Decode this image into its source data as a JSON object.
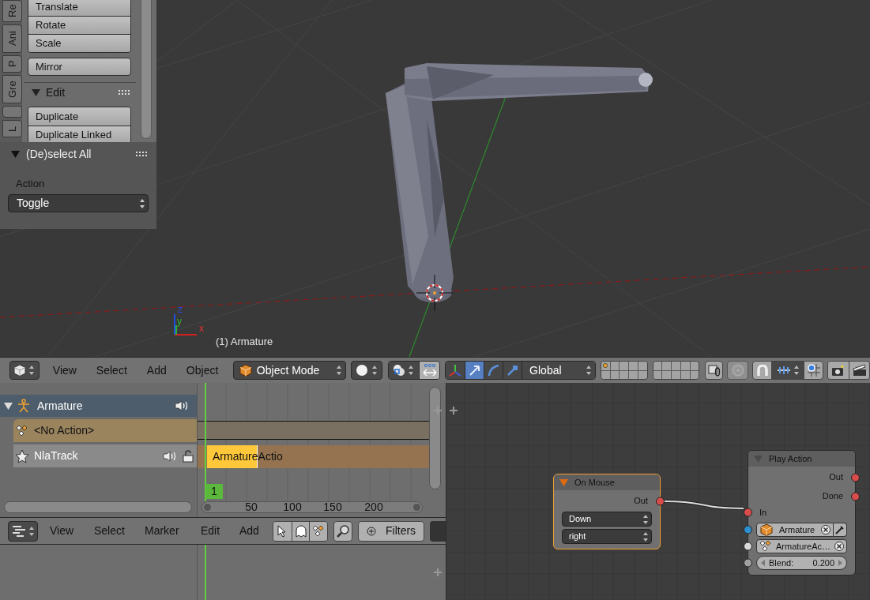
{
  "viewport": {
    "tool_tabs": [
      {
        "kind": "tab",
        "label": "Re"
      },
      {
        "kind": "tab",
        "label": "Ani"
      },
      {
        "kind": "tab",
        "label": "P"
      },
      {
        "kind": "tab",
        "label": "Gre"
      },
      {
        "kind": "blank"
      },
      {
        "kind": "tab",
        "label": "L"
      }
    ],
    "transform_buttons": [
      "Translate",
      "Rotate",
      "Scale"
    ],
    "mirror_button": "Mirror",
    "edit_panel": {
      "title": "Edit",
      "expanded": true,
      "buttons": [
        "Duplicate",
        "Duplicate Linked"
      ]
    },
    "operator_panel": {
      "title": "(De)select All",
      "expanded": true,
      "property": "Action",
      "value": "Toggle"
    },
    "axis_labels": [
      "z",
      "y",
      "x"
    ],
    "object_info": "(1) Armature"
  },
  "header": {
    "menus": [
      "View",
      "Select",
      "Add",
      "Object"
    ],
    "mode": "Object Mode",
    "manipulators": [
      {
        "kind": "axes",
        "selected": false
      },
      {
        "kind": "translate",
        "selected": true
      },
      {
        "kind": "rotate",
        "selected": false
      },
      {
        "kind": "scale",
        "selected": false
      }
    ],
    "orientation": "Global",
    "layers": [
      {
        "has_objects": true
      },
      {
        "has_objects": false
      },
      {
        "has_objects": false
      },
      {
        "has_objects": false
      },
      {
        "has_objects": false
      },
      {
        "has_objects": false
      },
      {
        "has_objects": false
      },
      {
        "has_objects": false
      },
      {
        "has_objects": false
      },
      {
        "has_objects": false
      },
      {
        "has_objects": false
      },
      {
        "has_objects": false
      },
      {
        "has_objects": false
      },
      {
        "has_objects": false
      },
      {
        "has_objects": false
      },
      {
        "has_objects": false
      },
      {
        "has_objects": false
      },
      {
        "has_objects": false
      },
      {
        "has_objects": false
      },
      {
        "has_objects": false
      }
    ]
  },
  "nla": {
    "channels": [
      {
        "kind": "object",
        "label": "Armature",
        "expanded": true
      },
      {
        "kind": "action",
        "label": "<No Action>"
      },
      {
        "kind": "track",
        "label": "NlaTrack"
      }
    ],
    "strip": "ArmatureActio",
    "current_frame": "1",
    "ruler": [
      "50",
      "100",
      "150",
      "200"
    ]
  },
  "nla_header": {
    "menus": [
      "View",
      "Select",
      "Marker",
      "Edit",
      "Add"
    ],
    "filters": "Filters"
  },
  "nodes": [
    {
      "title": "On Mouse",
      "selected": true,
      "expanded": true,
      "outputs": [
        {
          "label": "Out",
          "color": "#d94c4c"
        }
      ],
      "menus": [
        "Down",
        "right"
      ]
    },
    {
      "title": "Play Action",
      "selected": false,
      "expanded": true,
      "outputs": [
        {
          "label": "Out",
          "color": "#d94c4c"
        },
        {
          "label": "Done",
          "color": "#d94c4c"
        }
      ],
      "inputs": [
        {
          "kind": "label",
          "label": "In",
          "color": "#d94c4c",
          "linked": true
        },
        {
          "kind": "object",
          "label": "Armature",
          "color": "#2d8fcf"
        },
        {
          "kind": "action",
          "label": "ArmatureAc…",
          "color": "#d9d9d9"
        },
        {
          "kind": "number",
          "label": "Blend:",
          "value": "0.200",
          "color": "#a0a0a0"
        }
      ]
    }
  ]
}
